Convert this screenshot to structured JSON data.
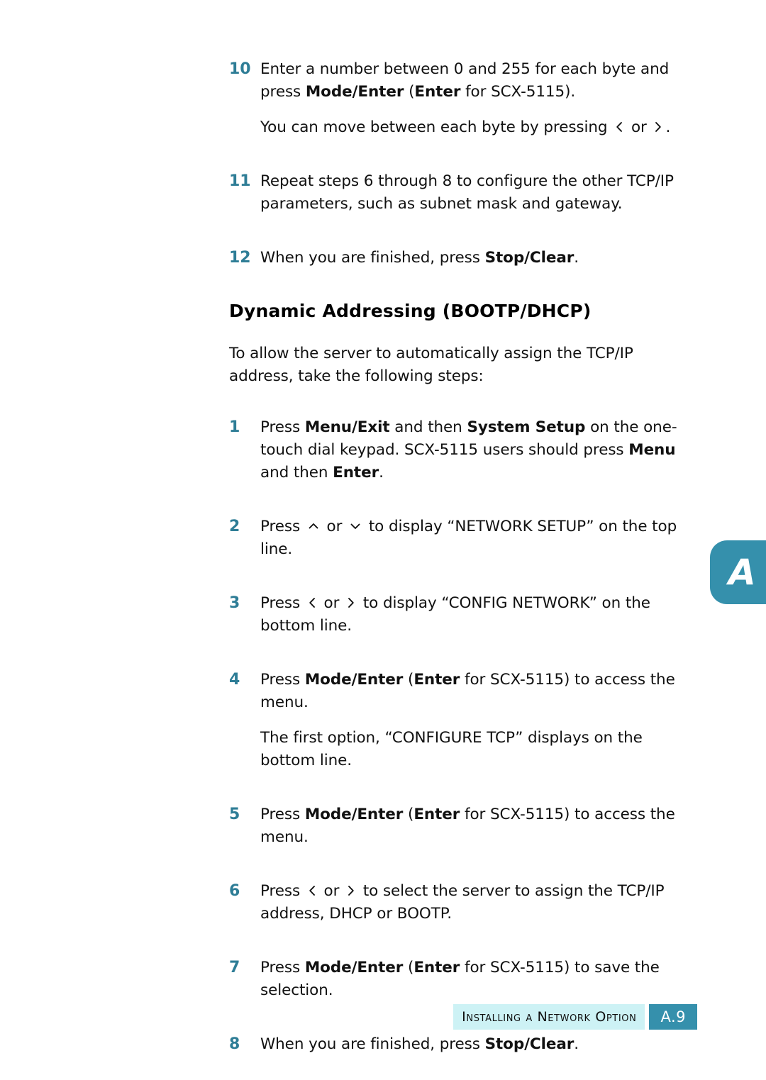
{
  "page": {
    "appendix_tab_letter": "A",
    "accent_teal": "#3590AC",
    "step_number_color": "#2E7D96",
    "footer_band_color": "#CDF2F5"
  },
  "icons": {
    "left_chevron": "chevron-left-icon",
    "right_chevron": "chevron-right-icon",
    "up_chevron": "chevron-up-icon",
    "down_chevron": "chevron-down-icon"
  },
  "top_steps": [
    {
      "number": "10",
      "line1_a": "Enter a number between 0 and 255 for each byte and press ",
      "line1_b": "Mode/Enter",
      "line1_c": " (",
      "line1_d": "Enter",
      "line1_e": " for SCX-5115).",
      "note_a": "You can move between each byte by pressing ",
      "note_b": " or ",
      "note_c": "."
    },
    {
      "number": "11",
      "text": "Repeat steps 6 through 8 to configure the other TCP/IP parameters, such as subnet mask and gateway."
    },
    {
      "number": "12",
      "text_a": "When you are finished, press ",
      "text_b": "Stop/Clear",
      "text_c": "."
    }
  ],
  "section": {
    "heading": "Dynamic Addressing (BOOTP/DHCP)",
    "intro": "To allow the server to automatically assign the TCP/IP address, take the following steps:"
  },
  "steps": [
    {
      "number": "1",
      "a": "Press ",
      "b": "Menu/Exit",
      "c": " and then ",
      "d": "System Setup",
      "e": " on the one-touch dial keypad. SCX-5115 users should press ",
      "f": "Menu",
      "g": " and then ",
      "h": "Enter",
      "i": "."
    },
    {
      "number": "2",
      "a": "Press ",
      "b": " or ",
      "c": " to display “NETWORK SETUP” on the top line."
    },
    {
      "number": "3",
      "a": "Press ",
      "b": " or ",
      "c": " to display “CONFIG NETWORK” on the bottom line."
    },
    {
      "number": "4",
      "a": "Press ",
      "b": "Mode/Enter",
      "c": " (",
      "d": "Enter",
      "e": " for SCX-5115) to access the menu.",
      "note": "The first option, “CONFIGURE TCP” displays on the bottom line."
    },
    {
      "number": "5",
      "a": "Press ",
      "b": "Mode/Enter",
      "c": " (",
      "d": "Enter",
      "e": " for SCX-5115) to access the menu."
    },
    {
      "number": "6",
      "a": "Press ",
      "b": " or ",
      "c": " to select the server to assign the TCP/IP address, DHCP or BOOTP."
    },
    {
      "number": "7",
      "a": "Press ",
      "b": "Mode/Enter",
      "c": " (",
      "d": "Enter",
      "e": " for SCX-5115) to save the selection."
    },
    {
      "number": "8",
      "a": "When you are finished, press ",
      "b": "Stop/Clear",
      "c": "."
    }
  ],
  "footer": {
    "title": "Installing a Network Option",
    "page_number": "A.9"
  }
}
